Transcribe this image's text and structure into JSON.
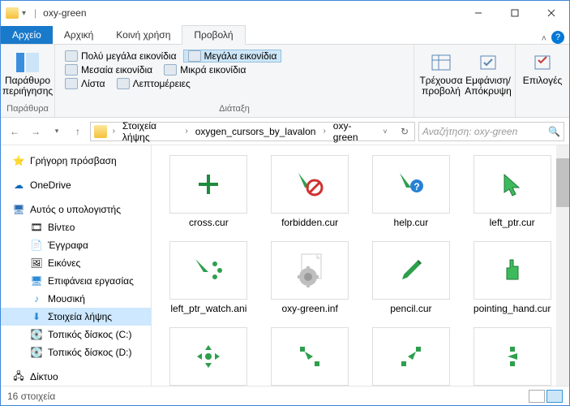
{
  "window": {
    "title": "oxy-green"
  },
  "tabs": {
    "file": "Αρχείο",
    "t1": "Αρχική",
    "t2": "Κοινή χρήση",
    "t3": "Προβολή"
  },
  "ribbon": {
    "pane_btn": "Παράθυρο περιήγησης",
    "g_panes": "Παράθυρα",
    "opt_xl": "Πολύ μεγάλα εικονίδια",
    "opt_lg": "Μεγάλα εικονίδια",
    "opt_md": "Μεσαία εικονίδια",
    "opt_sm": "Μικρά εικονίδια",
    "opt_list": "Λίστα",
    "opt_det": "Λεπτομέρειες",
    "g_layout": "Διάταξη",
    "cur_view": "Τρέχουσα προβολή",
    "showhide": "Εμφάνιση/ Απόκρυψη",
    "options": "Επιλογές"
  },
  "breadcrumbs": {
    "b1": "Στοιχεία λήψης",
    "b2": "oxygen_cursors_by_lavalon",
    "b3": "oxy-green"
  },
  "search": {
    "placeholder": "Αναζήτηση: oxy-green"
  },
  "tree": {
    "quick": "Γρήγορη πρόσβαση",
    "onedrive": "OneDrive",
    "thispc": "Αυτός ο υπολογιστής",
    "videos": "Βίντεο",
    "docs": "Έγγραφα",
    "pics": "Εικόνες",
    "desk": "Επιφάνεια εργασίας",
    "music": "Μουσική",
    "downloads": "Στοιχεία λήψης",
    "cdrive": "Τοπικός δίσκος (C:)",
    "ddrive": "Τοπικός δίσκος (D:)",
    "network": "Δίκτυο"
  },
  "files": {
    "f1": "cross.cur",
    "f2": "forbidden.cur",
    "f3": "help.cur",
    "f4": "left_ptr.cur",
    "f5": "left_ptr_watch.ani",
    "f6": "oxy-green.inf",
    "f7": "pencil.cur",
    "f8": "pointing_hand.cur"
  },
  "status": {
    "count": "16 στοιχεία"
  }
}
